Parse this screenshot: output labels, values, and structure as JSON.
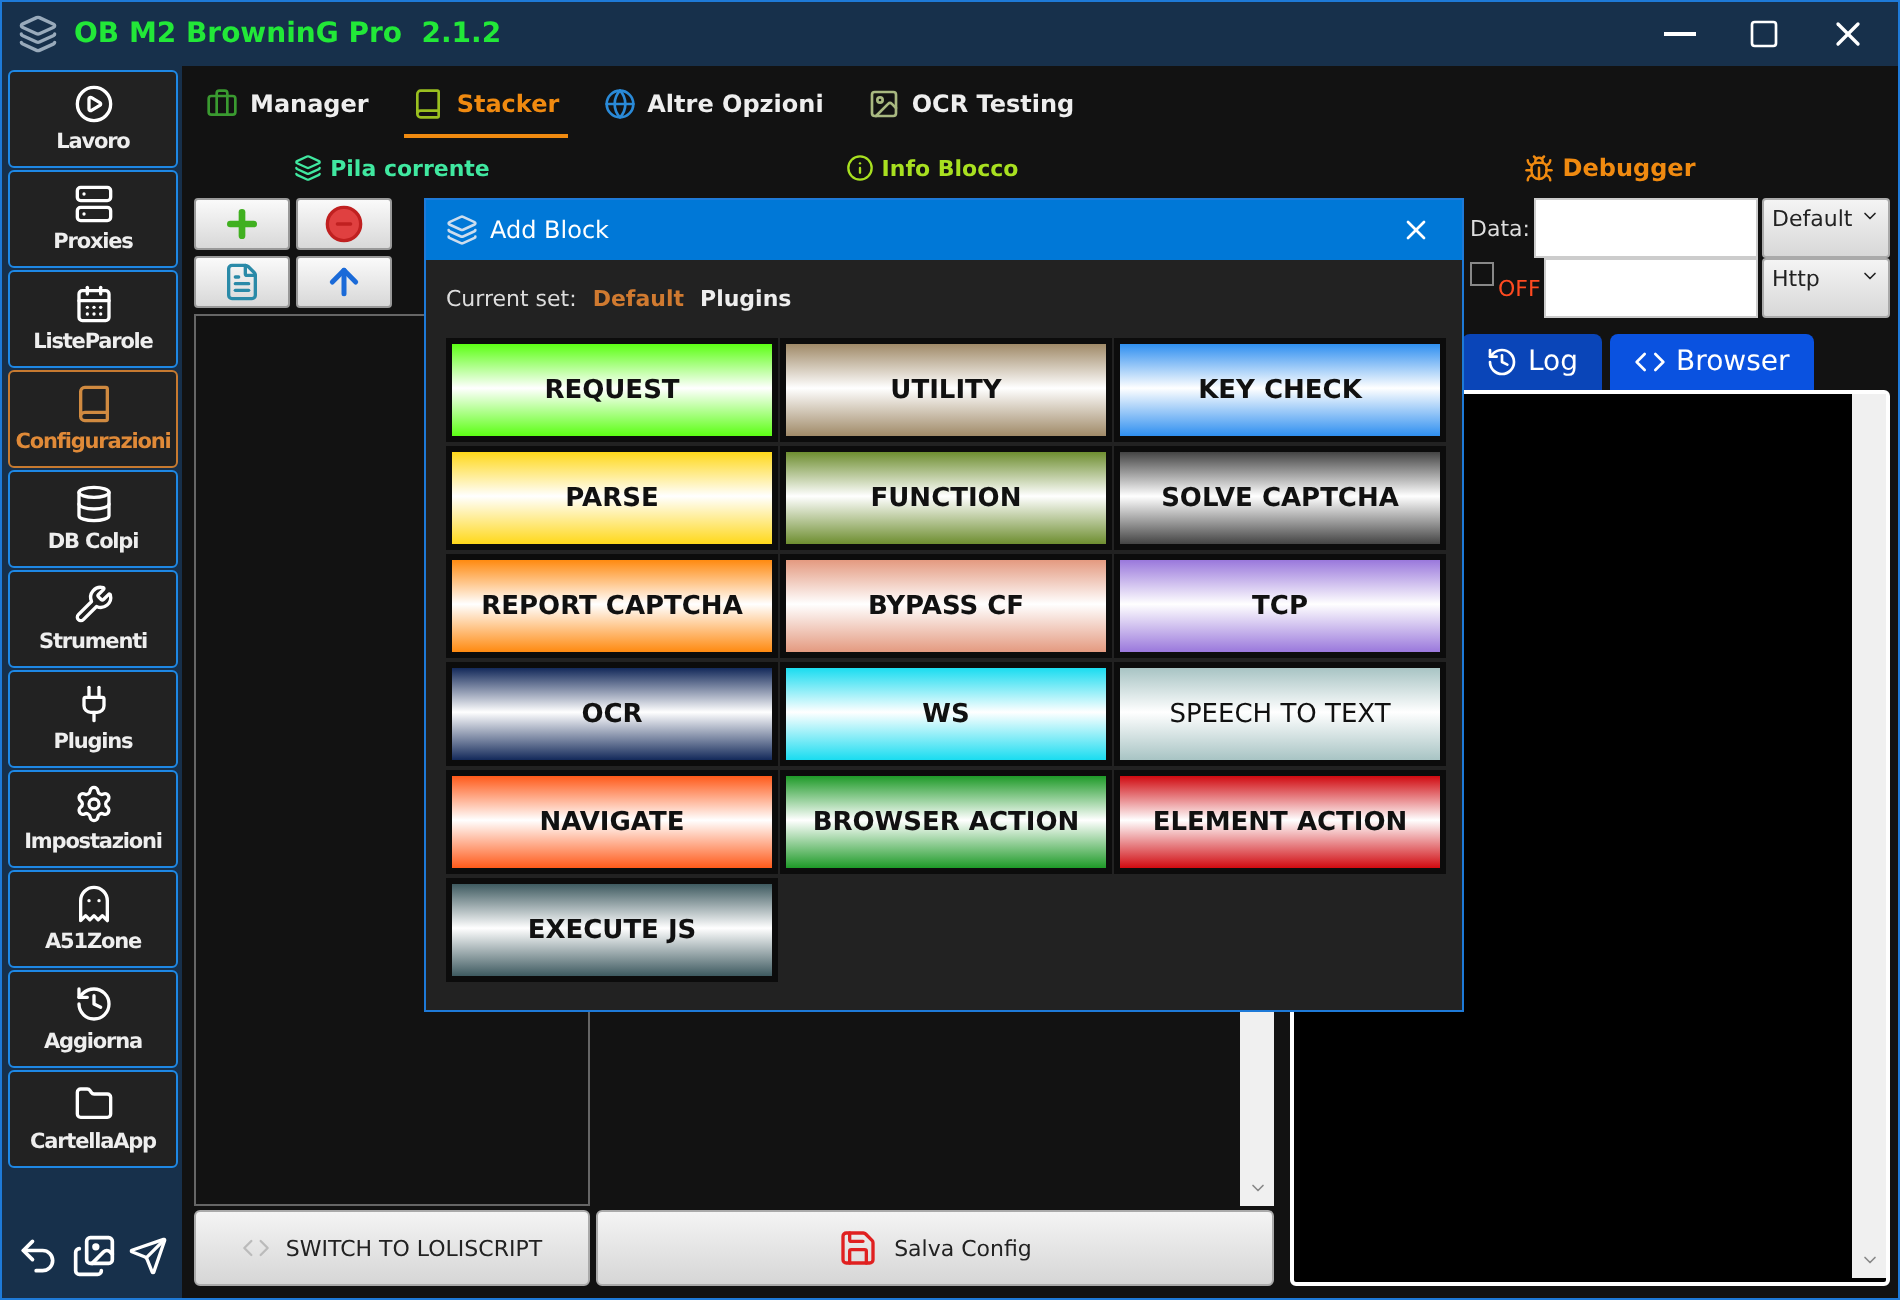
{
  "window": {
    "title": "OB M2 BrowninG Pro  2.1.2"
  },
  "sidebar": {
    "items": [
      {
        "label": "Lavoro",
        "selected": false
      },
      {
        "label": "Proxies",
        "selected": false
      },
      {
        "label": "ListeParole",
        "selected": false
      },
      {
        "label": "Configurazioni",
        "selected": true
      },
      {
        "label": "DB Colpi",
        "selected": false
      },
      {
        "label": "Strumenti",
        "selected": false
      },
      {
        "label": "Plugins",
        "selected": false
      },
      {
        "label": "Impostazioni",
        "selected": false
      },
      {
        "label": "A51Zone",
        "selected": false
      },
      {
        "label": "Aggiorna",
        "selected": false
      },
      {
        "label": "CartellaApp",
        "selected": false
      }
    ]
  },
  "tabs": [
    {
      "label": "Manager",
      "selected": false
    },
    {
      "label": "Stacker",
      "selected": true
    },
    {
      "label": "Altre Opzioni",
      "selected": false
    },
    {
      "label": "OCR Testing",
      "selected": false
    }
  ],
  "stack_panel": {
    "title": "Pila corrente"
  },
  "block_info": {
    "title": "Info Blocco"
  },
  "debugger": {
    "title": "Debugger",
    "data_label": "Data:",
    "data_type": "Default",
    "proxy_checked": false,
    "proxy_state": "OFF",
    "proxy_type": "Http",
    "tabs": [
      {
        "label": "Log",
        "selected": false
      },
      {
        "label": "Browser",
        "selected": true
      }
    ]
  },
  "bottom_buttons": {
    "switch": "SWITCH TO LOLISCRIPT",
    "save": "Salva Config"
  },
  "dialog": {
    "title": "Add Block",
    "current_set_label": "Current set:",
    "sets": [
      {
        "label": "Default",
        "selected": true
      },
      {
        "label": "Plugins",
        "selected": false
      }
    ],
    "blocks": [
      {
        "label": "REQUEST",
        "color": "#5cff14",
        "bold": true
      },
      {
        "label": "UTILITY",
        "color": "#a08a68",
        "bold": true
      },
      {
        "label": "KEY CHECK",
        "color": "#2f8ff0",
        "bold": true
      },
      {
        "label": "PARSE",
        "color": "#ffd81a",
        "bold": true
      },
      {
        "label": "FUNCTION",
        "color": "#6e8e30",
        "bold": true
      },
      {
        "label": "SOLVE CAPTCHA",
        "color": "#444444",
        "bold": true
      },
      {
        "label": "REPORT CAPTCHA",
        "color": "#ff8a10",
        "bold": true
      },
      {
        "label": "BYPASS CF",
        "color": "#e49a80",
        "bold": true
      },
      {
        "label": "TCP",
        "color": "#9a78dc",
        "bold": true
      },
      {
        "label": "OCR",
        "color": "#13295a",
        "bold": true
      },
      {
        "label": "WS",
        "color": "#1adcf0",
        "bold": true
      },
      {
        "label": "SPEECH TO TEXT",
        "color": "#a8c4c4",
        "bold": false
      },
      {
        "label": "NAVIGATE",
        "color": "#ff5a1a",
        "bold": true
      },
      {
        "label": "BROWSER ACTION",
        "color": "#1e9a28",
        "bold": true
      },
      {
        "label": "ELEMENT ACTION",
        "color": "#d00a10",
        "bold": true
      },
      {
        "label": "EXECUTE JS",
        "color": "#3e5a60",
        "bold": true
      }
    ]
  }
}
